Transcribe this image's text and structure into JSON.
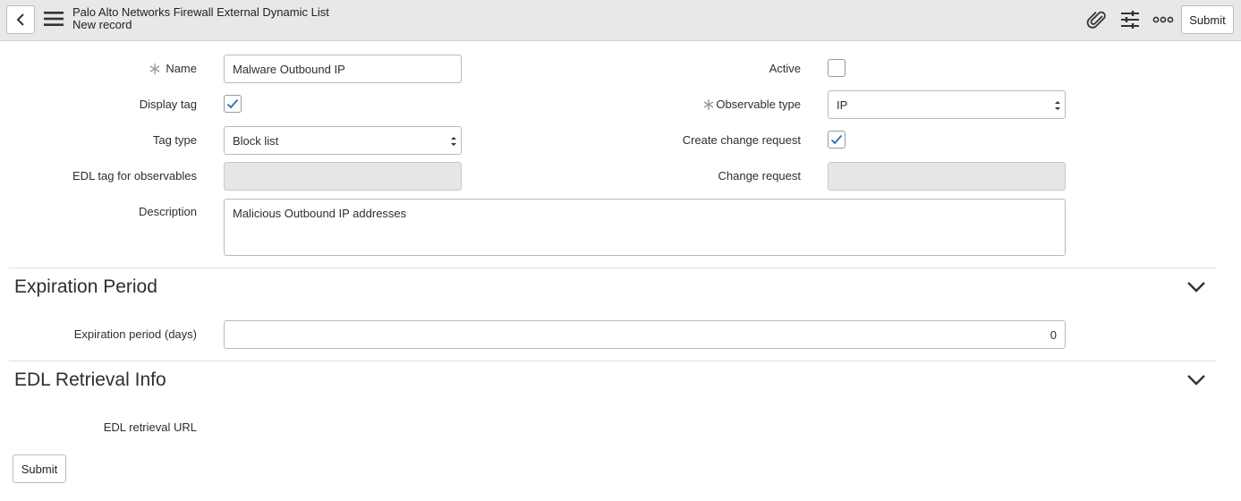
{
  "header": {
    "title": "Palo Alto Networks Firewall External Dynamic List",
    "subtitle": "New record",
    "submit_label": "Submit"
  },
  "form": {
    "name": {
      "label": "Name",
      "value": "Malware Outbound IP",
      "required": true
    },
    "active": {
      "label": "Active",
      "checked": false
    },
    "display_tag": {
      "label": "Display tag",
      "checked": true
    },
    "observable_type": {
      "label": "Observable type",
      "value": "IP",
      "required": true
    },
    "tag_type": {
      "label": "Tag type",
      "value": "Block list"
    },
    "create_change_request": {
      "label": "Create change request",
      "checked": true
    },
    "edl_tag": {
      "label": "EDL tag for observables",
      "value": ""
    },
    "change_request": {
      "label": "Change request",
      "value": ""
    },
    "description": {
      "label": "Description",
      "value": "Malicious Outbound IP addresses"
    }
  },
  "sections": {
    "expiration": {
      "title": "Expiration Period",
      "period_label": "Expiration period (days)",
      "period_value": "0"
    },
    "edl_retrieval": {
      "title": "EDL Retrieval Info",
      "url_label": "EDL retrieval URL"
    }
  },
  "footer": {
    "submit_label": "Submit"
  },
  "colors": {
    "check": "#2a6fbf",
    "required_star": "#9a9a9a",
    "header_bg": "#e8e8e9"
  }
}
